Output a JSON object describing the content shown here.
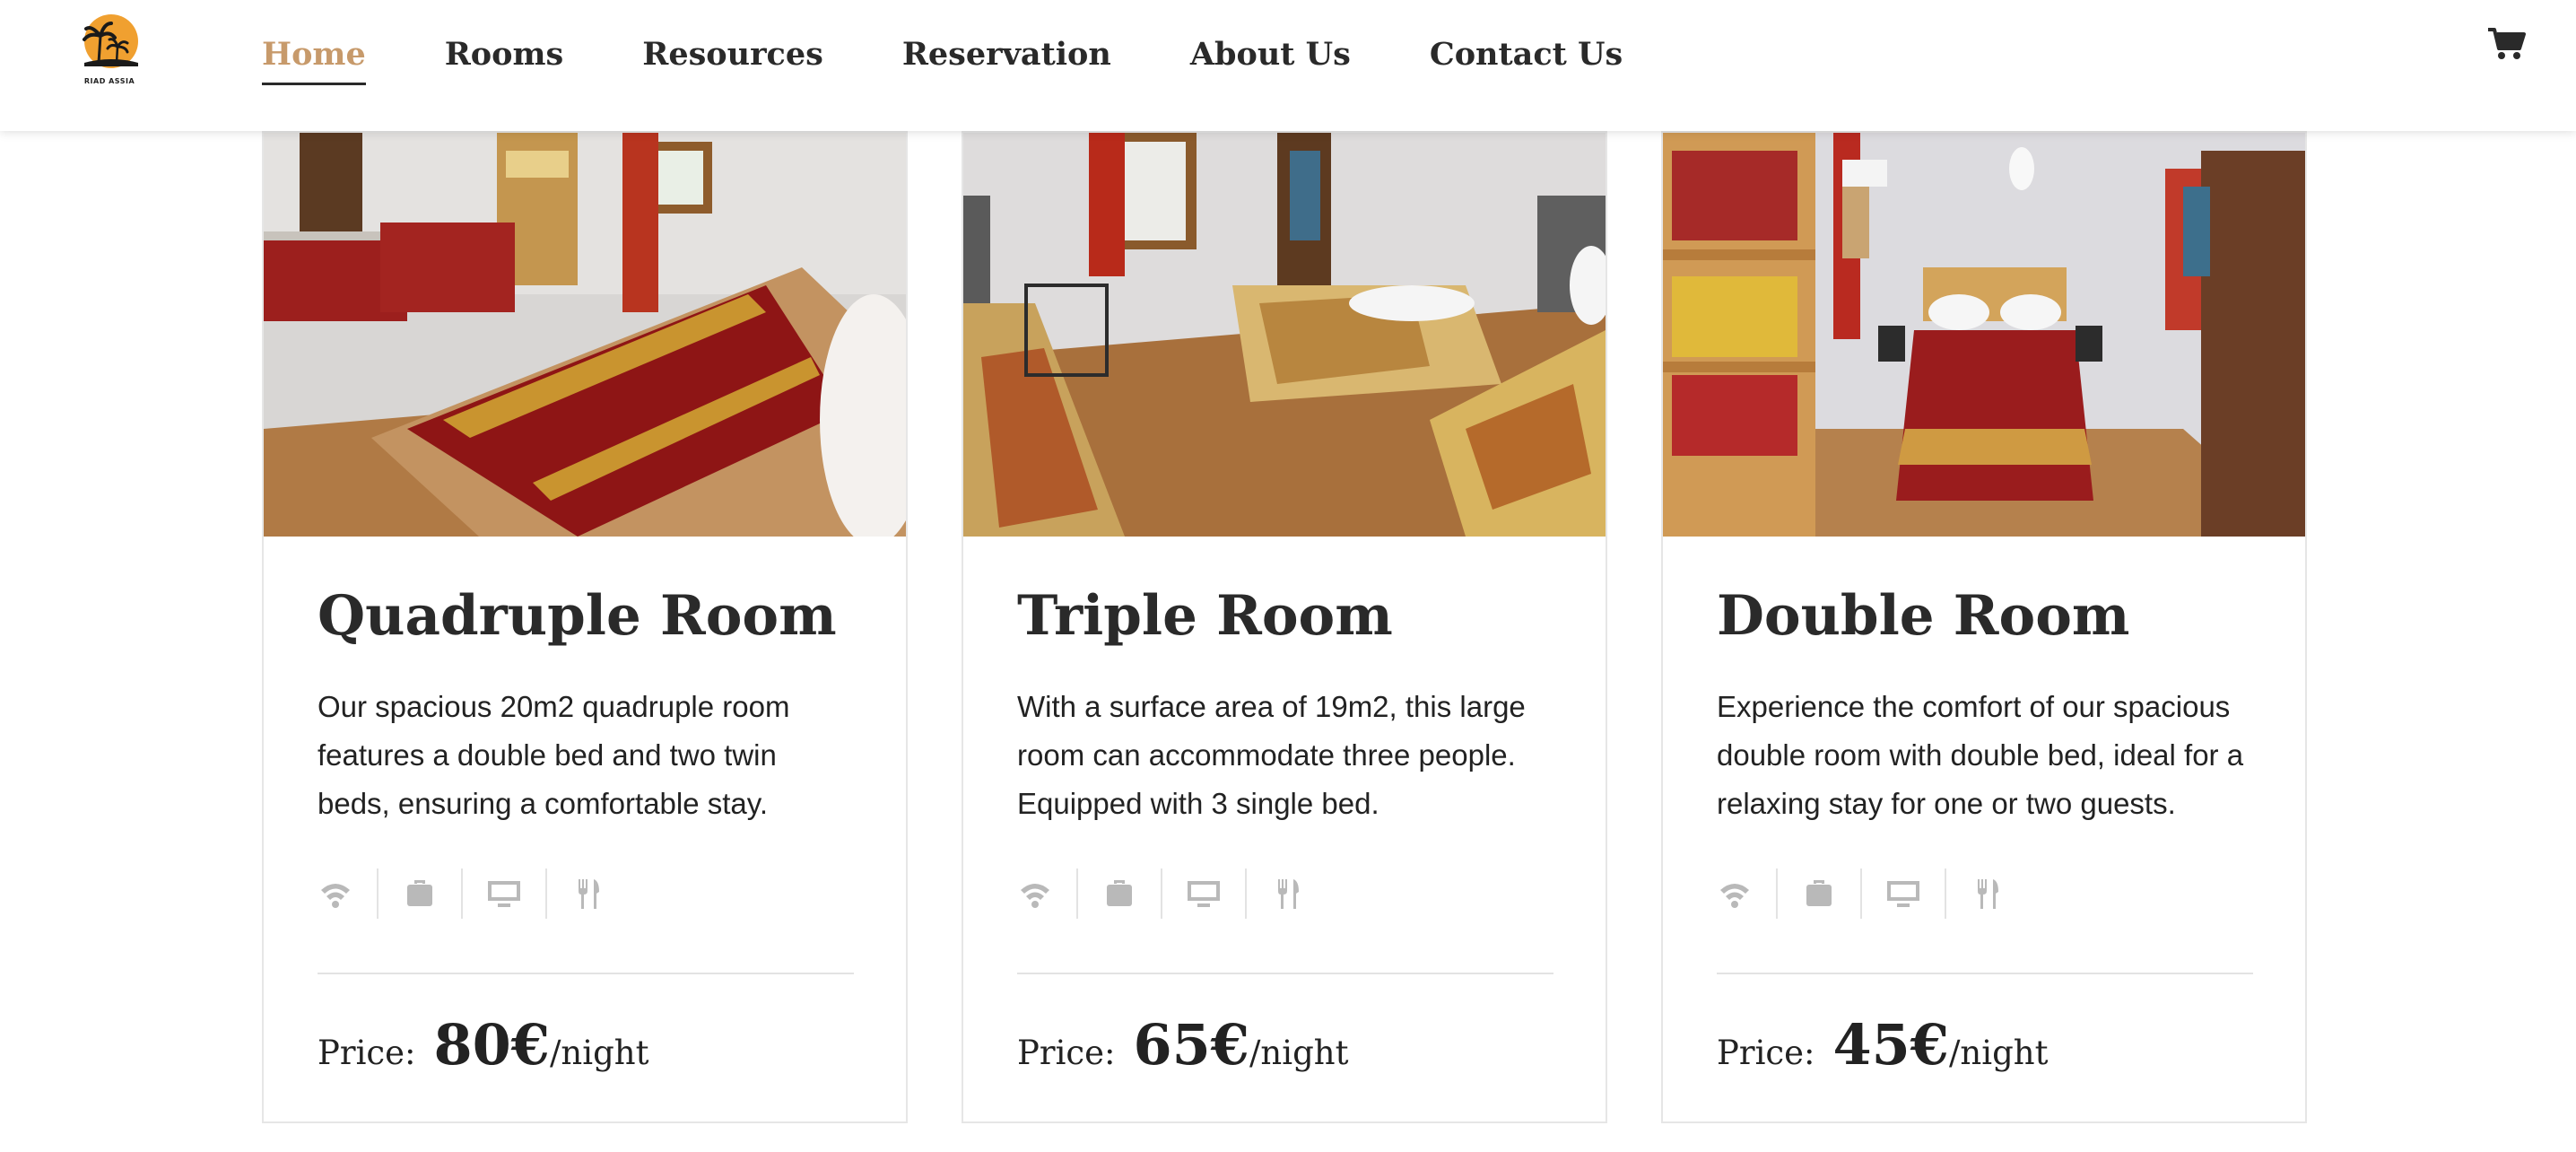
{
  "brand": {
    "logo_text": "RIAD ASSIA"
  },
  "nav": {
    "links": [
      {
        "label": "Home",
        "active": true
      },
      {
        "label": "Rooms"
      },
      {
        "label": "Resources"
      },
      {
        "label": "Reservation"
      },
      {
        "label": "About Us"
      },
      {
        "label": "Contact Us"
      }
    ],
    "cart_icon": "shopping-cart-icon"
  },
  "rooms": [
    {
      "title": "Quadruple Room",
      "description": "Our spacious 20m2 quadruple room features a double bed and two twin beds, ensuring a comfortable stay.",
      "price_label": "Price:",
      "price": "80€",
      "unit": "/night"
    },
    {
      "title": "Triple Room",
      "description": "With a surface area of 19m2, this large room can accommodate three people. Equipped with 3 single bed.",
      "price_label": "Price:",
      "price": "65€",
      "unit": "/night"
    },
    {
      "title": "Double Room",
      "description": "Experience the comfort of our spacious double room with double bed, ideal for a relaxing stay for one or two guests.",
      "price_label": "Price:",
      "price": "45€",
      "unit": "/night"
    }
  ],
  "amenity_icons": [
    "wifi-icon",
    "luggage-icon",
    "tv-icon",
    "restaurant-icon"
  ],
  "colors": {
    "accent": "#c79a6b",
    "text": "#2a2a2a",
    "icon": "#b9b9b9",
    "border": "#e6e6e6"
  }
}
